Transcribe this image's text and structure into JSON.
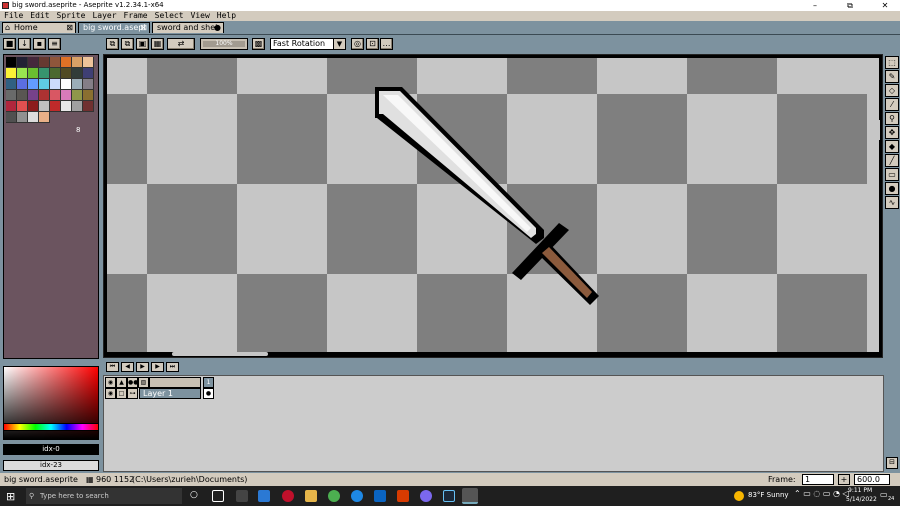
{
  "window": {
    "title": "big sword.aseprite - Aseprite v1.2.34.1-x64",
    "min": "–",
    "max": "⧉",
    "close": "✕"
  },
  "menu": [
    "File",
    "Edit",
    "Sprite",
    "Layer",
    "Frame",
    "Select",
    "View",
    "Help"
  ],
  "tabs": [
    {
      "label": "Home",
      "icon": "home-icon"
    },
    {
      "label": "big sword.asepi",
      "active": true
    },
    {
      "label": "sword and shei"
    }
  ],
  "toolbar": {
    "zoom_label": "100%",
    "rotation_algorithm": "Fast Rotation"
  },
  "palette": {
    "colors": [
      "#000000",
      "#222034",
      "#45283c",
      "#663931",
      "#8f563b",
      "#df7126",
      "#d9a066",
      "#eec39a",
      "#fbf236",
      "#99e550",
      "#6abe30",
      "#37946e",
      "#4b692f",
      "#524b24",
      "#323c39",
      "#3f3f74",
      "#306082",
      "#5b6ee1",
      "#639bff",
      "#5fcde4",
      "#cbdbfc",
      "#ffffff",
      "#9badb7",
      "#847e87",
      "#696a6a",
      "#595652",
      "#76428a",
      "#ac3232",
      "#d95763",
      "#d77bba",
      "#8f974a",
      "#8a6f30",
      "#b0263c",
      "#e05050",
      "#8c1c1c",
      "#c0c0c0",
      "#bf2a2a",
      "#e8e8e8",
      "#a0a0a0",
      "#703030",
      "#505050",
      "#909090",
      "#dcdcdc",
      "#e8b088"
    ],
    "count": "8"
  },
  "color_bar": {
    "foreground": "idx-0",
    "background": "idx-23"
  },
  "timeline": {
    "frame_number": "1",
    "layers": [
      {
        "name": "Layer 1"
      }
    ]
  },
  "status": {
    "file": "big sword.aseprite",
    "size": "960 1152",
    "path": "(C:\\Users\\zurieh\\Documents)",
    "frame_label": "Frame:",
    "frame_value": "1",
    "zoom_value": "600.0"
  },
  "taskbar": {
    "search_placeholder": "Type here to search",
    "weather": "83°F Sunny",
    "time": "9:11 PM",
    "date": "5/14/2022",
    "notifications": "24"
  },
  "colors": {
    "accent": "#7d929f",
    "panel": "#6b545f",
    "face": "#d3cbbe"
  }
}
